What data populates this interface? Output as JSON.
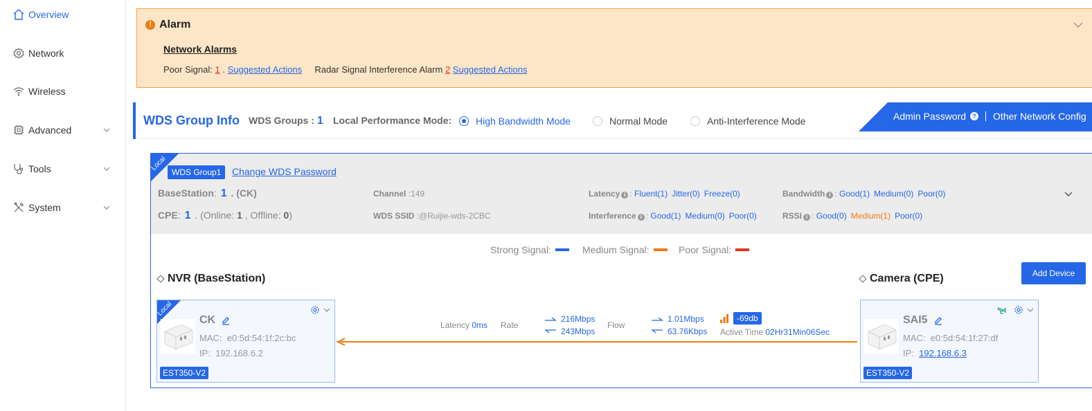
{
  "sidebar": {
    "items": [
      {
        "label": "Overview",
        "icon": "home-icon",
        "active": true
      },
      {
        "label": "Network",
        "icon": "gear-icon"
      },
      {
        "label": "Wireless",
        "icon": "wifi-icon"
      },
      {
        "label": "Advanced",
        "icon": "chip-icon",
        "expandable": true
      },
      {
        "label": "Tools",
        "icon": "stethoscope-icon",
        "expandable": true
      },
      {
        "label": "System",
        "icon": "tools-icon",
        "expandable": true
      }
    ]
  },
  "alarm": {
    "icon_glyph": "!",
    "title": "Alarm",
    "subtitle": "Network Alarms",
    "poor_signal_label": "Poor Signal:",
    "poor_signal_count": "1",
    "sep": ".",
    "action_label": "Suggested Actions",
    "radar_label": "Radar Signal Interference Alarm",
    "radar_count": "2",
    "radar_action_label": "Suggested Actions"
  },
  "wds": {
    "title": "WDS Group Info",
    "groups_label": "WDS Groups :",
    "groups_count": "1",
    "perf_label": "Local Performance Mode:",
    "modes": [
      {
        "label": "High Bandwidth Mode",
        "checked": true
      },
      {
        "label": "Normal Mode",
        "checked": false
      },
      {
        "label": "Anti-Interference Mode",
        "checked": false
      }
    ],
    "admin_password": "Admin Password",
    "help_glyph": "?",
    "other_config": "Other Network Config"
  },
  "group": {
    "corner_label": "Local",
    "name": "WDS Group1",
    "change_password": "Change WDS Password",
    "base_label": "BaseStation",
    "base_count": "1",
    "base_name": ". (CK)",
    "cpe_label": "CPE",
    "cpe_count": "1",
    "cpe_online_pre": ". (Online:",
    "cpe_online": "1",
    "cpe_offline_pre": ", Offline:",
    "cpe_offline": "0",
    "cpe_close": ")",
    "channel_label": "Channel",
    "channel_value": ":149",
    "ssid_label": "WDS SSID",
    "ssid_value": ":@Ruijie-wds-2CBC",
    "latency_label": "Latency",
    "latency_vals": [
      "Fluent(1)",
      "Jitter(0)",
      "Freeze(0)"
    ],
    "interference_label": "Interference",
    "interference_vals": [
      "Good(1)",
      "Medium(0)",
      "Poor(0)"
    ],
    "bandwidth_label": "Bandwidth",
    "bandwidth_vals": [
      "Good(1)",
      "Medium(0)",
      "Poor(0)"
    ],
    "rssi_label": "RSSI",
    "rssi_vals": [
      "Good(0)",
      "Medium(1)",
      "Poor(0)"
    ],
    "info_glyph": "i",
    "colon": ":"
  },
  "legend": {
    "strong": "Strong Signal:",
    "medium": "Medium Signal:",
    "poor": "Poor Signal:",
    "colors": {
      "strong": "#2667e8",
      "medium": "#f07a14",
      "poor": "#e5331f"
    }
  },
  "base_section": {
    "title": "NVR (BaseStation)"
  },
  "cpe_section": {
    "title": "Camera (CPE)",
    "add_button": "Add Device"
  },
  "base_device": {
    "corner_label": "Local",
    "name": "CK",
    "mac_label": "MAC:",
    "mac": "e0:5d:54:1f:2c:bc",
    "ip_label": "IP:",
    "ip": "192.168.6.2",
    "model": "EST350-V2"
  },
  "cpe_device": {
    "name": "SAI5",
    "mac_label": "MAC:",
    "mac": "e0:5d:54:1f:27:df",
    "ip_label": "IP:",
    "ip": "192.168.6.3",
    "model": "EST350-V2"
  },
  "link": {
    "latency_label": "Latency",
    "latency_value": "0ms",
    "rate_label": "Rate",
    "rate_up": "216Mbps",
    "rate_down": "243Mbps",
    "flow_label": "Flow",
    "flow_up": "1.01Mbps",
    "flow_down": "63.76Kbps",
    "signal_db": "-69db",
    "active_label": "Active Time",
    "active_value": "02Hr31Min06Sec",
    "link_color": "#f07a14"
  }
}
